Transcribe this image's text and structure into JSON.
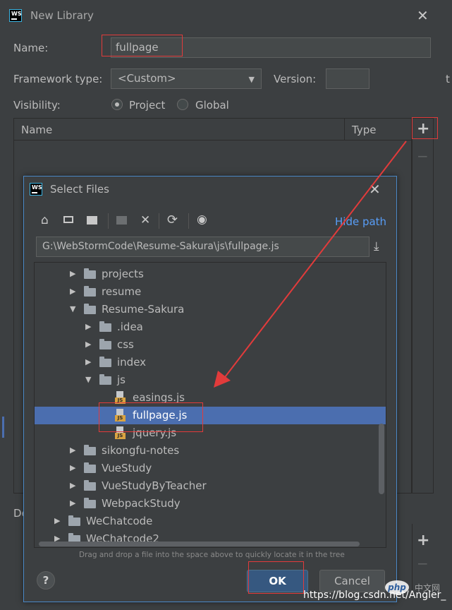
{
  "dialog": {
    "title": "New Library",
    "name_label": "Name:",
    "name_value": "fullpage",
    "framework_label": "Framework type:",
    "framework_value": "<Custom>",
    "version_label": "Version:",
    "version_value": "",
    "visibility_label": "Visibility:",
    "visibility_options": [
      "Project",
      "Global"
    ],
    "visibility_selected": "Project",
    "table_headers": [
      "Name",
      "Type"
    ],
    "partial_label": "De",
    "edge_char": "t"
  },
  "select_files": {
    "title": "Select Files",
    "hide_path_link": "Hide path",
    "path_value": "G:\\WebStormCode\\Resume-Sakura\\js\\fullpage.js",
    "tree": [
      {
        "name": "projects",
        "type": "folder",
        "expanded": false
      },
      {
        "name": "resume",
        "type": "folder",
        "expanded": false
      },
      {
        "name": "Resume-Sakura",
        "type": "folder",
        "expanded": true
      },
      {
        "name": ".idea",
        "type": "folder",
        "expanded": false
      },
      {
        "name": "css",
        "type": "folder",
        "expanded": false
      },
      {
        "name": "index",
        "type": "folder",
        "expanded": false
      },
      {
        "name": "js",
        "type": "folder",
        "expanded": true
      },
      {
        "name": "easings.js",
        "type": "js"
      },
      {
        "name": "fullpage.js",
        "type": "js",
        "selected": true
      },
      {
        "name": "jquery.js",
        "type": "js"
      },
      {
        "name": "sikongfu-notes",
        "type": "folder",
        "expanded": false
      },
      {
        "name": "VueStudy",
        "type": "folder",
        "expanded": false
      },
      {
        "name": "VueStudyByTeacher",
        "type": "folder",
        "expanded": false
      },
      {
        "name": "WebpackStudy",
        "type": "folder",
        "expanded": false
      },
      {
        "name": "WeChatcode",
        "type": "folder",
        "expanded": false
      },
      {
        "name": "WeChatcode2",
        "type": "folder",
        "expanded": false
      }
    ],
    "drop_hint": "Drag and drop a file into the space above to quickly locate it in the tree",
    "ok_label": "OK",
    "cancel_label": "Cancel",
    "help_label": "?"
  },
  "watermark": {
    "php_text": "php",
    "cn_text": "中文网",
    "url_text": "https://blog.csdn.net/Angler_"
  },
  "colors": {
    "background": "#3c3f41",
    "selection": "#4b6eaf",
    "link": "#589df6",
    "annotation_red": "#e23b3b"
  }
}
